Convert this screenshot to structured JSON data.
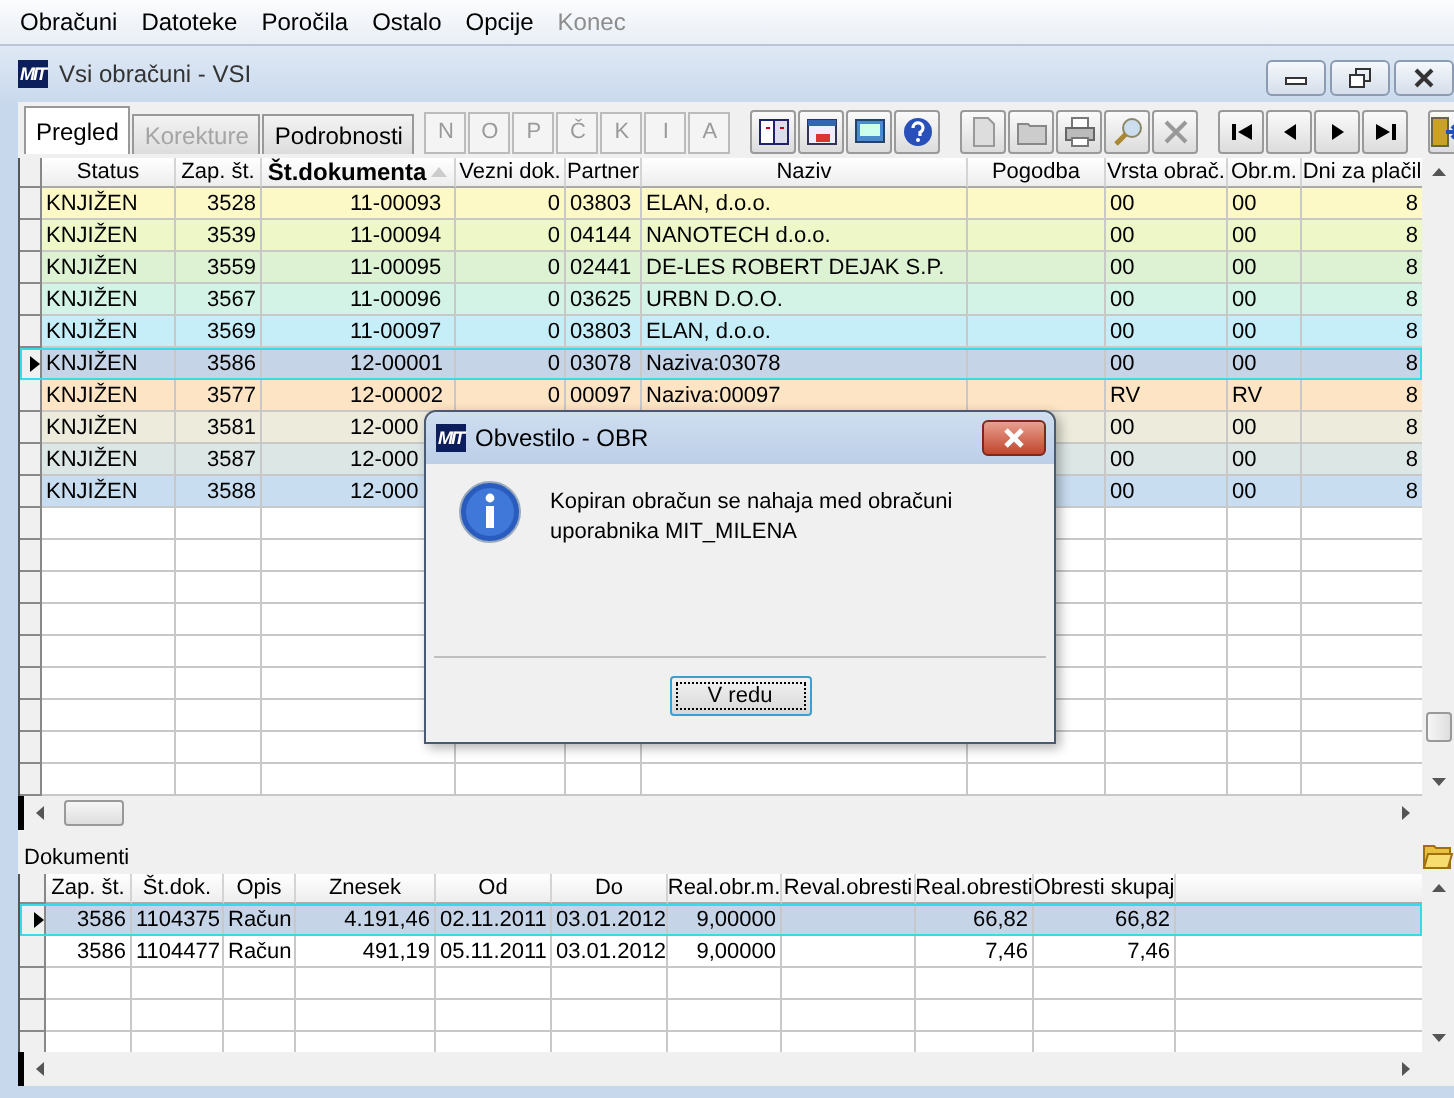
{
  "menu": [
    {
      "label": "Obračuni",
      "disabled": false
    },
    {
      "label": "Datoteke",
      "disabled": false
    },
    {
      "label": "Poročila",
      "disabled": false
    },
    {
      "label": "Ostalo",
      "disabled": false
    },
    {
      "label": "Opcije",
      "disabled": false
    },
    {
      "label": "Konec",
      "disabled": true
    }
  ],
  "window": {
    "logo": "MIT",
    "title": "Vsi obračuni - VSI"
  },
  "tabs": [
    {
      "label": "Pregled",
      "selected": true,
      "disabled": false
    },
    {
      "label": "Korekture",
      "selected": false,
      "disabled": true
    },
    {
      "label": "Podrobnosti",
      "selected": false,
      "disabled": false
    }
  ],
  "letter_buttons": [
    {
      "label": "N",
      "disabled": true
    },
    {
      "label": "O",
      "disabled": true
    },
    {
      "label": "P",
      "disabled": true
    },
    {
      "label": "Č",
      "disabled": true
    },
    {
      "label": "K",
      "disabled": true
    },
    {
      "label": "I",
      "disabled": true
    },
    {
      "label": "A",
      "disabled": true
    }
  ],
  "table": {
    "columns": [
      {
        "label": "Status",
        "sorted": false
      },
      {
        "label": "Zap. št.",
        "sorted": false
      },
      {
        "label": "Št.dokumenta",
        "sorted": true
      },
      {
        "label": "Vezni dok.",
        "sorted": false
      },
      {
        "label": "Partner",
        "sorted": false
      },
      {
        "label": "Naziv",
        "sorted": false
      },
      {
        "label": "Pogodba",
        "sorted": false
      },
      {
        "label": "Vrsta obrač.",
        "sorted": false
      },
      {
        "label": "Obr.m.",
        "sorted": false
      },
      {
        "label": "Dni za plačil",
        "sorted": false
      }
    ],
    "rows": [
      {
        "selected": false,
        "color": "#fdf9c6",
        "status": "KNJIŽEN",
        "zap": "3528",
        "doc": "11-00093",
        "vezni": "0",
        "partner": "03803",
        "naziv": "ELAN, d.o.o.",
        "vrsta": "00",
        "obrm": "00",
        "dni": "8"
      },
      {
        "selected": false,
        "color": "#eef7c8",
        "status": "KNJIŽEN",
        "zap": "3539",
        "doc": "11-00094",
        "vezni": "0",
        "partner": "04144",
        "naziv": "NANOTECH d.o.o.",
        "vrsta": "00",
        "obrm": "00",
        "dni": "8"
      },
      {
        "selected": false,
        "color": "#ddf2d2",
        "status": "KNJIŽEN",
        "zap": "3559",
        "doc": "11-00095",
        "vezni": "0",
        "partner": "02441",
        "naziv": "DE-LES ROBERT DEJAK S.P.",
        "vrsta": "00",
        "obrm": "00",
        "dni": "8"
      },
      {
        "selected": false,
        "color": "#d3f3e6",
        "status": "KNJIŽEN",
        "zap": "3567",
        "doc": "11-00096",
        "vezni": "0",
        "partner": "03625",
        "naziv": "URBN D.O.O.",
        "vrsta": "00",
        "obrm": "00",
        "dni": "8"
      },
      {
        "selected": false,
        "color": "#c6eef8",
        "status": "KNJIŽEN",
        "zap": "3569",
        "doc": "11-00097",
        "vezni": "0",
        "partner": "03803",
        "naziv": "ELAN, d.o.o.",
        "vrsta": "00",
        "obrm": "00",
        "dni": "8"
      },
      {
        "selected": true,
        "color": "#c6d4e7",
        "status": "KNJIŽEN",
        "zap": "3586",
        "doc": "12-00001",
        "vezni": "0",
        "partner": "03078",
        "naziv": "Naziva:03078",
        "vrsta": "00",
        "obrm": "00",
        "dni": "8"
      },
      {
        "selected": false,
        "color": "#fde4c4",
        "status": "KNJIŽEN",
        "zap": "3577",
        "doc": "12-00002",
        "vezni": "0",
        "partner": "00097",
        "naziv": "Naziva:00097",
        "vrsta": "RV",
        "obrm": "RV",
        "dni": "8"
      },
      {
        "selected": false,
        "color": "#ecebdc",
        "status": "KNJIŽEN",
        "zap": "3581",
        "doc": "12-000",
        "vrsta": "00",
        "obrm": "00",
        "dni": "8"
      },
      {
        "selected": false,
        "color": "#dce6e4",
        "status": "KNJIŽEN",
        "zap": "3587",
        "doc": "12-000",
        "vrsta": "00",
        "obrm": "00",
        "dni": "8"
      },
      {
        "selected": false,
        "color": "#c9ddf0",
        "status": "KNJIŽEN",
        "zap": "3588",
        "doc": "12-000",
        "vrsta": "00",
        "obrm": "00",
        "dni": "8"
      }
    ]
  },
  "documents": {
    "label": "Dokumenti",
    "columns": [
      "Zap. št.",
      "Št.dok.",
      "Opis",
      "Znesek",
      "Od",
      "Do",
      "Real.obr.m.",
      "Reval.obresti",
      "Real.obresti",
      "Obresti skupaj"
    ],
    "rows": [
      {
        "selected": true,
        "zap": "3586",
        "stdok": "1104375",
        "opis": "Račun",
        "znesek": "4.191,46",
        "od": "02.11.2011",
        "do": "03.01.2012",
        "realobrm": "9,00000",
        "realobr": "66,82",
        "skupaj": "66,82"
      },
      {
        "selected": false,
        "zap": "3586",
        "stdok": "1104477",
        "opis": "Račun",
        "znesek": "491,19",
        "od": "05.11.2011",
        "do": "03.01.2012",
        "realobrm": "9,00000",
        "realobr": "7,46",
        "skupaj": "7,46"
      }
    ]
  },
  "dialog": {
    "logo": "MIT",
    "title": "Obvestilo - OBR",
    "message": "Kopiran obračun se nahaja med obračuni uporabnika MIT_MILENA",
    "button": "V redu"
  }
}
